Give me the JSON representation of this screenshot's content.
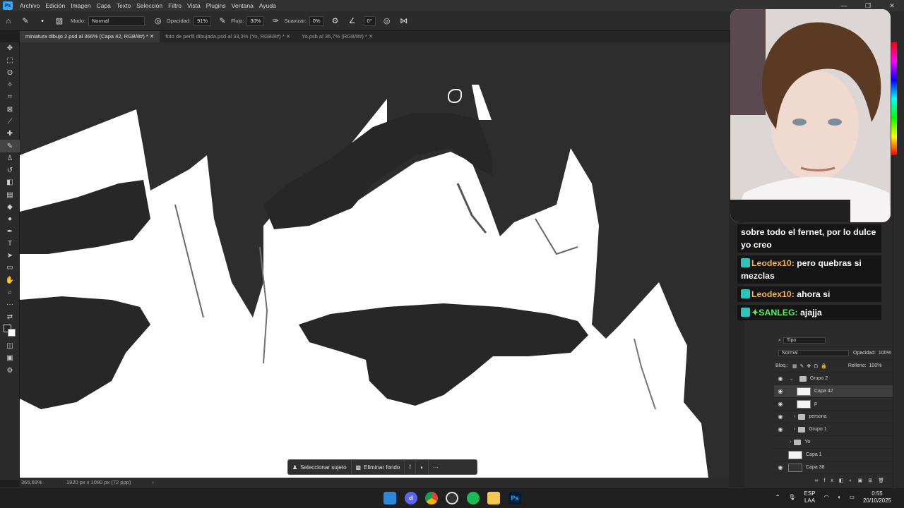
{
  "menu": {
    "app_icon": "Ps",
    "items": [
      "Archivo",
      "Edición",
      "Imagen",
      "Capa",
      "Texto",
      "Selección",
      "Filtro",
      "Vista",
      "Plugins",
      "Ventana",
      "Ayuda"
    ]
  },
  "options": {
    "mode_label": "Modo:",
    "mode_value": "Normal",
    "opacity_label": "Opacidad:",
    "opacity_value": "91%",
    "flow_label": "Flujo:",
    "flow_value": "30%",
    "smooth_label": "Suavizar:",
    "smooth_value": "0%",
    "angle_value": "0°"
  },
  "tabs": [
    {
      "label": "miniatura dibujo 2.psd al 366% (Capa 42, RGB/8#) *",
      "active": true
    },
    {
      "label": "foto de perfil dibujada.psd al 33,3% (Yo, RGB/8#) *",
      "active": false
    },
    {
      "label": "Yo.psb al 36,7% (RGB/8#) *",
      "active": false
    }
  ],
  "status": {
    "zoom": "365,69%",
    "doc_info": "1920 px x 1080 px (72 ppp)"
  },
  "context_bar": {
    "select_subject": "Seleccionar sujeto",
    "remove_bg": "Eliminar fondo"
  },
  "chat": [
    {
      "user": "",
      "text": "sobre todo el fernet, por lo dulce yo creo"
    },
    {
      "user": "Leodex10:",
      "text": "pero quebras si mezclas"
    },
    {
      "user": "Leodex10:",
      "text": "ahora si"
    },
    {
      "user": "✦SANLEG:",
      "text": "ajajja"
    }
  ],
  "layers_panel": {
    "filter": "Tipo",
    "blend_mode": "Normal",
    "opacity_label": "Opacidad:",
    "opacity_value": "100%",
    "lock_label": "Bloq.:",
    "fill_label": "Relleno:",
    "fill_value": "100%",
    "layers": [
      {
        "name": "Grupo 2",
        "type": "group",
        "visible": true,
        "selected": false
      },
      {
        "name": "Capa 42",
        "type": "layer",
        "visible": true,
        "selected": true
      },
      {
        "name": "p",
        "type": "layer",
        "visible": true,
        "selected": false
      },
      {
        "name": "persona",
        "type": "group",
        "visible": true,
        "selected": false
      },
      {
        "name": "Grupo 1",
        "type": "group",
        "visible": true,
        "selected": false
      },
      {
        "name": "Yo",
        "type": "group",
        "visible": false,
        "selected": false
      },
      {
        "name": "Capa 1",
        "type": "layer",
        "visible": false,
        "selected": false
      },
      {
        "name": "Capa 38",
        "type": "layer",
        "visible": true,
        "selected": false
      }
    ]
  },
  "tray": {
    "lang1": "ESP",
    "lang2": "LAA",
    "time": "0:55",
    "date": "20/10/2025"
  },
  "colors": {
    "accent": "#31a8ff",
    "canvas_dark": "#2d2d2d"
  }
}
